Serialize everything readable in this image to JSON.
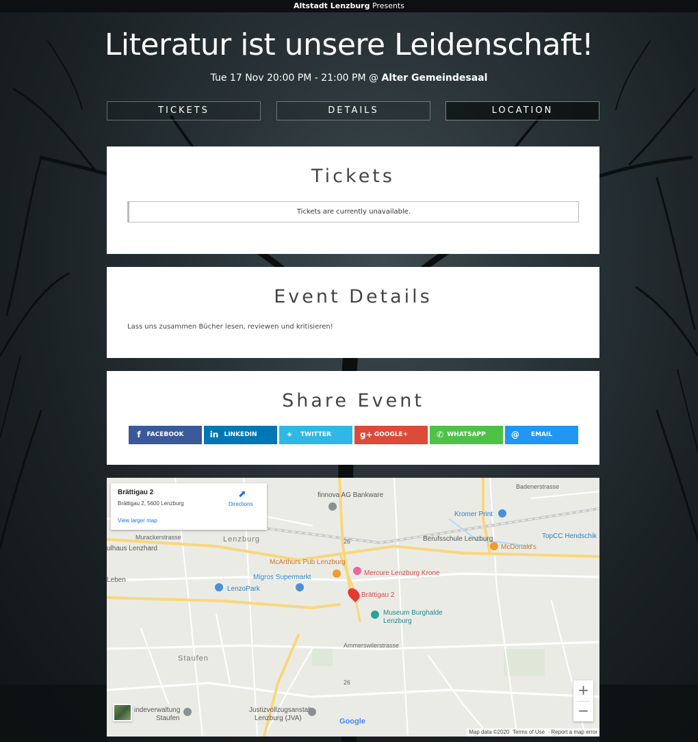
{
  "header": {
    "organizer": "Altstadt Lenzburg",
    "presents": "Presents"
  },
  "event": {
    "title": "Literatur ist unsere Leidenschaft!",
    "datetime": "Tue 17 Nov 20:00 PM - 21:00 PM @",
    "venue": "Alter Gemeindesaal"
  },
  "nav": {
    "tickets": "TICKETS",
    "details": "DETAILS",
    "location": "LOCATION"
  },
  "tickets": {
    "heading": "Tickets",
    "message": "Tickets are currently unavailable."
  },
  "details": {
    "heading": "Event Details",
    "description": "Lass uns zusammen Bücher lesen, reviewen und kritisieren!"
  },
  "share": {
    "heading": "Share Event",
    "buttons": [
      {
        "label": "FACEBOOK",
        "icon": "facebook-icon",
        "color": "#3b5998"
      },
      {
        "label": "LINKEDIN",
        "icon": "linkedin-icon",
        "color": "#0077b5"
      },
      {
        "label": "TWITTER",
        "icon": "twitter-icon",
        "color": "#2fb8e6"
      },
      {
        "label": "GOOGLE+",
        "icon": "google-plus-icon",
        "color": "#dc4a38"
      },
      {
        "label": "WHATSAPP",
        "icon": "whatsapp-icon",
        "color": "#4dc247"
      },
      {
        "label": "EMAIL",
        "icon": "email-icon",
        "color": "#2196f3"
      }
    ]
  },
  "map": {
    "place_name": "Brättigau 2",
    "place_address": "Brättigau 2, 5600 Lenzburg",
    "larger_map": "View larger map",
    "directions": "Directions",
    "google": "Google",
    "attribution_data": "Map data ©2020",
    "attribution_terms": "Terms of Use",
    "attribution_report": "Report a map error",
    "zoom_in": "+",
    "zoom_out": "−",
    "labels": {
      "badenerstrasse": "Badenerstrasse",
      "finnova": "finnova AG Bankware",
      "kromer": "Kromer Print",
      "topcc": "TopCC Hendschik",
      "muracker": "Murackerstrasse",
      "lenzburg": "Lenzburg",
      "berufsschule": "Berufsschule Lenzburg",
      "mcdonalds": "McDonald's",
      "ullhaus": "ulhaus Lenzhard",
      "mcarthurs": "McArthurs Pub Lenzburg",
      "mercure": "Mercure Lenzburg Krone",
      "leben": "Leben",
      "migros": "Migros Supermarkt",
      "lenzopark": "LenzoPark",
      "brattigau": "Brättigau 2",
      "museum": "Museum Burghalde",
      "museum2": "Lenzburg",
      "staufen": "Staufen",
      "verwaltung": "indeverwaltung",
      "verwaltung2": "Staufen",
      "jva": "Justizvollzugsanstalt",
      "jva2": "Lenzburg (JVA)",
      "ammerswil": "Ammerswilerstrasse",
      "route26a": "26",
      "route26b": "26"
    }
  }
}
